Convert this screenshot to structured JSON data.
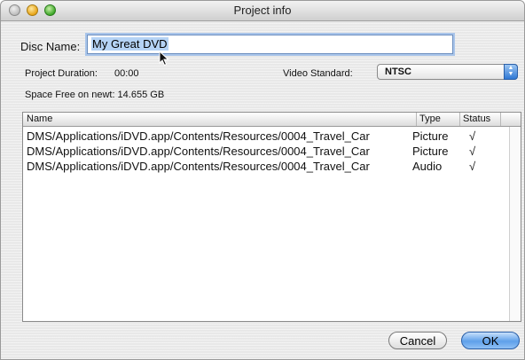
{
  "window": {
    "title": "Project info"
  },
  "disc": {
    "label": "Disc Name:",
    "value": "My Great DVD"
  },
  "info": {
    "duration_label": "Project Duration:",
    "duration_value": "00:00",
    "video_standard_label": "Video Standard:",
    "video_standard_value": "NTSC",
    "space_free": "Space Free on newt: 14.655 GB"
  },
  "table": {
    "columns": [
      "Name",
      "Type",
      "Status"
    ],
    "rows": [
      {
        "name": "DMS/Applications/iDVD.app/Contents/Resources/0004_Travel_Car",
        "type": "Picture",
        "status": "√"
      },
      {
        "name": "DMS/Applications/iDVD.app/Contents/Resources/0004_Travel_Car",
        "type": "Picture",
        "status": "√"
      },
      {
        "name": "DMS/Applications/iDVD.app/Contents/Resources/0004_Travel_Car",
        "type": "Audio",
        "status": "√"
      }
    ]
  },
  "buttons": {
    "cancel": "Cancel",
    "ok": "OK"
  },
  "icons": {
    "close": "close-icon",
    "minimize": "minimize-icon",
    "zoom": "zoom-icon",
    "pointer": "arrow-pointer-icon",
    "select_arrows": "up-down-arrows-icon"
  }
}
